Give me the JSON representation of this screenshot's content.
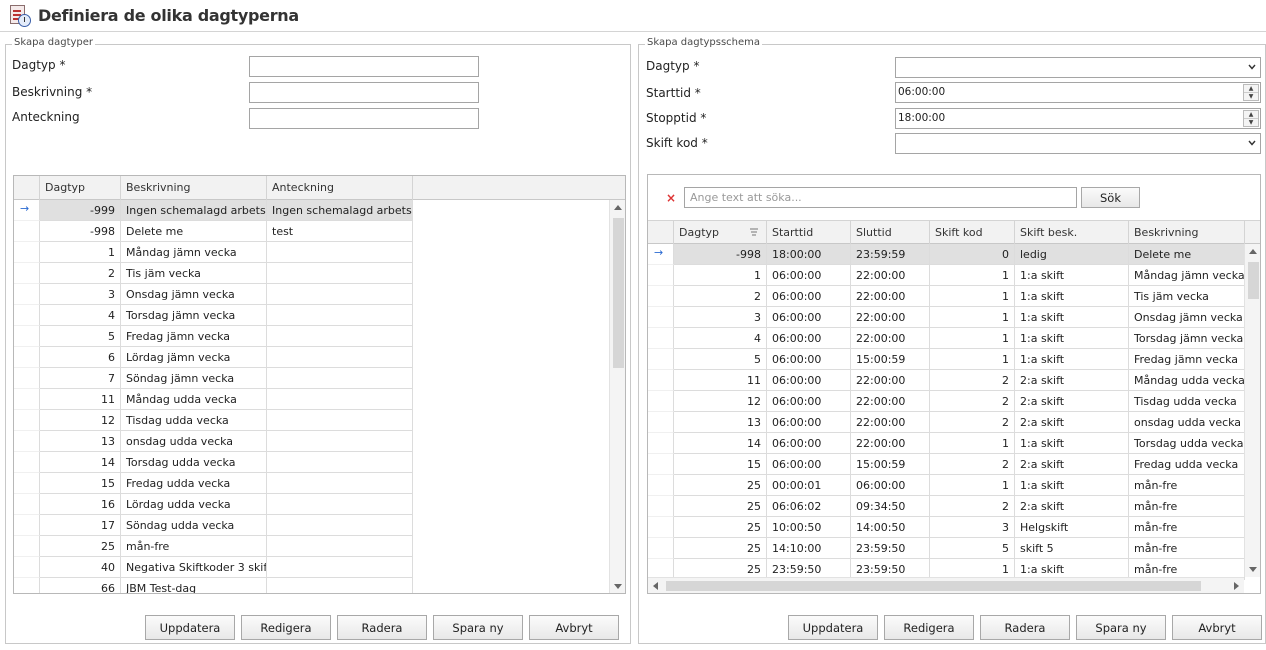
{
  "window": {
    "title": "Definiera de olika dagtyperna"
  },
  "left_group": {
    "legend": "Skapa dagtyper",
    "fields": {
      "dagtyp_label": "Dagtyp *",
      "dagtyp_value": "",
      "beskrivning_label": "Beskrivning *",
      "beskrivning_value": "",
      "anteckning_label": "Anteckning",
      "anteckning_value": ""
    },
    "grid": {
      "columns": [
        "Dagtyp",
        "Beskrivning",
        "Anteckning"
      ],
      "rows": [
        {
          "dagtyp": "-999",
          "beskrivning": "Ingen schemalagd arbetstid",
          "anteckning": "Ingen schemalagd arbetstid"
        },
        {
          "dagtyp": "-998",
          "beskrivning": "Delete me",
          "anteckning": "test"
        },
        {
          "dagtyp": "1",
          "beskrivning": "Måndag jämn vecka",
          "anteckning": ""
        },
        {
          "dagtyp": "2",
          "beskrivning": "Tis jäm vecka",
          "anteckning": ""
        },
        {
          "dagtyp": "3",
          "beskrivning": "Onsdag jämn vecka",
          "anteckning": ""
        },
        {
          "dagtyp": "4",
          "beskrivning": "Torsdag jämn vecka",
          "anteckning": ""
        },
        {
          "dagtyp": "5",
          "beskrivning": "Fredag jämn vecka",
          "anteckning": ""
        },
        {
          "dagtyp": "6",
          "beskrivning": "Lördag jämn vecka",
          "anteckning": ""
        },
        {
          "dagtyp": "7",
          "beskrivning": "Söndag jämn vecka",
          "anteckning": ""
        },
        {
          "dagtyp": "11",
          "beskrivning": "Måndag udda vecka",
          "anteckning": ""
        },
        {
          "dagtyp": "12",
          "beskrivning": "Tisdag udda vecka",
          "anteckning": ""
        },
        {
          "dagtyp": "13",
          "beskrivning": "onsdag udda vecka",
          "anteckning": ""
        },
        {
          "dagtyp": "14",
          "beskrivning": "Torsdag udda vecka",
          "anteckning": ""
        },
        {
          "dagtyp": "15",
          "beskrivning": "Fredag udda vecka",
          "anteckning": ""
        },
        {
          "dagtyp": "16",
          "beskrivning": "Lördag udda vecka",
          "anteckning": ""
        },
        {
          "dagtyp": "17",
          "beskrivning": "Söndag udda vecka",
          "anteckning": ""
        },
        {
          "dagtyp": "25",
          "beskrivning": "mån-fre",
          "anteckning": ""
        },
        {
          "dagtyp": "40",
          "beskrivning": "Negativa Skiftkoder 3 skift",
          "anteckning": ""
        },
        {
          "dagtyp": "66",
          "beskrivning": "JBM Test-dag",
          "anteckning": ""
        }
      ]
    },
    "buttons": [
      "Uppdatera",
      "Redigera",
      "Radera",
      "Spara ny",
      "Avbryt"
    ]
  },
  "right_group": {
    "legend": "Skapa dagtypsschema",
    "fields": {
      "dagtyp_label": "Dagtyp *",
      "dagtyp_value": "",
      "starttid_label": "Starttid *",
      "starttid_value": "06:00:00",
      "stopptid_label": "Stopptid *",
      "stopptid_value": "18:00:00",
      "skiftkod_label": "Skift kod *",
      "skiftkod_value": ""
    },
    "search": {
      "placeholder": "Ange text att söka...",
      "button": "Sök"
    },
    "grid": {
      "columns": [
        "Dagtyp",
        "Starttid",
        "Sluttid",
        "Skift kod",
        "Skift besk.",
        "Beskrivning"
      ],
      "rows": [
        {
          "dagtyp": "-998",
          "starttid": "18:00:00",
          "sluttid": "23:59:59",
          "skiftkod": "0",
          "skiftbesk": "ledig",
          "beskrivning": "Delete me"
        },
        {
          "dagtyp": "1",
          "starttid": "06:00:00",
          "sluttid": "22:00:00",
          "skiftkod": "1",
          "skiftbesk": "1:a skift",
          "beskrivning": "Måndag jämn vecka"
        },
        {
          "dagtyp": "2",
          "starttid": "06:00:00",
          "sluttid": "22:00:00",
          "skiftkod": "1",
          "skiftbesk": "1:a skift",
          "beskrivning": "Tis jäm vecka"
        },
        {
          "dagtyp": "3",
          "starttid": "06:00:00",
          "sluttid": "22:00:00",
          "skiftkod": "1",
          "skiftbesk": "1:a skift",
          "beskrivning": "Onsdag jämn vecka"
        },
        {
          "dagtyp": "4",
          "starttid": "06:00:00",
          "sluttid": "22:00:00",
          "skiftkod": "1",
          "skiftbesk": "1:a skift",
          "beskrivning": "Torsdag jämn vecka"
        },
        {
          "dagtyp": "5",
          "starttid": "06:00:00",
          "sluttid": "15:00:59",
          "skiftkod": "1",
          "skiftbesk": "1:a skift",
          "beskrivning": "Fredag jämn vecka"
        },
        {
          "dagtyp": "11",
          "starttid": "06:00:00",
          "sluttid": "22:00:00",
          "skiftkod": "2",
          "skiftbesk": "2:a skift",
          "beskrivning": "Måndag udda vecka"
        },
        {
          "dagtyp": "12",
          "starttid": "06:00:00",
          "sluttid": "22:00:00",
          "skiftkod": "2",
          "skiftbesk": "2:a skift",
          "beskrivning": "Tisdag udda vecka"
        },
        {
          "dagtyp": "13",
          "starttid": "06:00:00",
          "sluttid": "22:00:00",
          "skiftkod": "2",
          "skiftbesk": "2:a skift",
          "beskrivning": "onsdag udda vecka"
        },
        {
          "dagtyp": "14",
          "starttid": "06:00:00",
          "sluttid": "22:00:00",
          "skiftkod": "1",
          "skiftbesk": "1:a skift",
          "beskrivning": "Torsdag udda vecka"
        },
        {
          "dagtyp": "15",
          "starttid": "06:00:00",
          "sluttid": "15:00:59",
          "skiftkod": "2",
          "skiftbesk": "2:a skift",
          "beskrivning": "Fredag udda vecka"
        },
        {
          "dagtyp": "25",
          "starttid": "00:00:01",
          "sluttid": "06:00:00",
          "skiftkod": "1",
          "skiftbesk": "1:a skift",
          "beskrivning": "mån-fre"
        },
        {
          "dagtyp": "25",
          "starttid": "06:06:02",
          "sluttid": "09:34:50",
          "skiftkod": "2",
          "skiftbesk": "2:a skift",
          "beskrivning": "mån-fre"
        },
        {
          "dagtyp": "25",
          "starttid": "10:00:50",
          "sluttid": "14:00:50",
          "skiftkod": "3",
          "skiftbesk": "Helgskift",
          "beskrivning": "mån-fre"
        },
        {
          "dagtyp": "25",
          "starttid": "14:10:00",
          "sluttid": "23:59:50",
          "skiftkod": "5",
          "skiftbesk": "skift  5",
          "beskrivning": "mån-fre"
        },
        {
          "dagtyp": "25",
          "starttid": "23:59:50",
          "sluttid": "23:59:50",
          "skiftkod": "1",
          "skiftbesk": "1:a skift",
          "beskrivning": "mån-fre"
        }
      ]
    },
    "buttons": [
      "Uppdatera",
      "Redigera",
      "Radera",
      "Spara ny",
      "Avbryt"
    ]
  },
  "colors": {
    "accent": "#2a6ad2",
    "selected_row": "#e0e0e0",
    "border": "#a5a5a5"
  }
}
